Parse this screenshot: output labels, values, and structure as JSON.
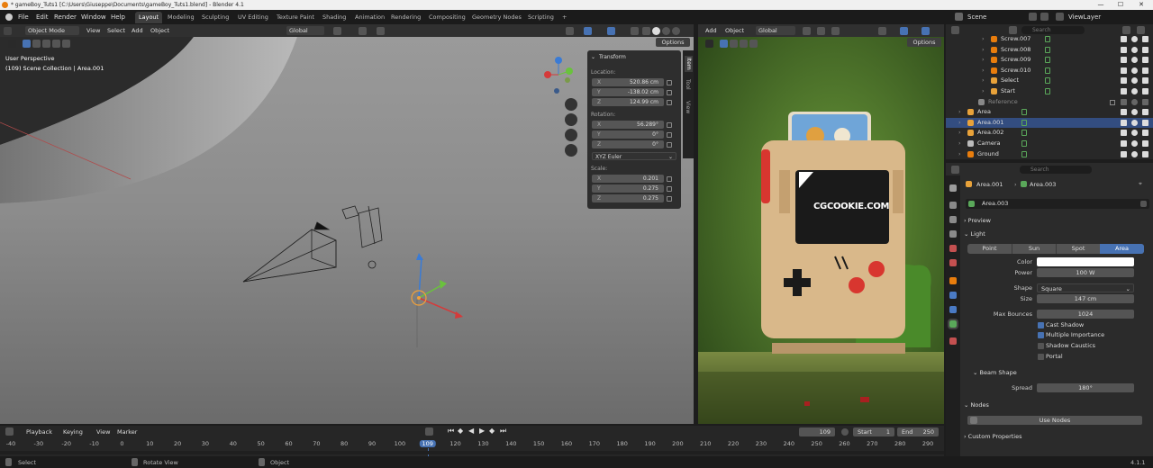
{
  "window": {
    "title": "* gameBoy_Tuts1 [C:\\Users\\Giuseppe\\Documents\\gameBoy_Tuts1.blend] - Blender 4.1"
  },
  "menubar": {
    "items": [
      "File",
      "Edit",
      "Render",
      "Window",
      "Help"
    ]
  },
  "workspaces": [
    "Layout",
    "Modeling",
    "Sculpting",
    "UV Editing",
    "Texture Paint",
    "Shading",
    "Animation",
    "Rendering",
    "Compositing",
    "Geometry Nodes",
    "Scripting"
  ],
  "workspace_add": "+",
  "scene": {
    "label": "Scene",
    "viewlayer": "ViewLayer"
  },
  "viewport_header": {
    "mode": "Object Mode",
    "view": "View",
    "select": "Select",
    "add": "Add",
    "object": "Object",
    "orientation": "Global",
    "options": "Options"
  },
  "viewport": {
    "perspective": "User Perspective",
    "collection": "(109) Scene Collection | Area.001"
  },
  "npanel": {
    "title": "Transform",
    "location_label": "Location:",
    "location": [
      {
        "axis": "X",
        "value": "520.86 cm"
      },
      {
        "axis": "Y",
        "value": "-138.02 cm"
      },
      {
        "axis": "Z",
        "value": "124.99 cm"
      }
    ],
    "rotation_label": "Rotation:",
    "rotation": [
      {
        "axis": "X",
        "value": "56.289°"
      },
      {
        "axis": "Y",
        "value": "0°"
      },
      {
        "axis": "Z",
        "value": "0°"
      }
    ],
    "rotation_mode": "XYZ Euler",
    "scale_label": "Scale:",
    "scale": [
      {
        "axis": "X",
        "value": "0.201"
      },
      {
        "axis": "Y",
        "value": "0.275"
      },
      {
        "axis": "Z",
        "value": "0.275"
      }
    ],
    "tabs": [
      "Item",
      "Tool",
      "View"
    ]
  },
  "render_header": {
    "add": "Add",
    "object": "Object",
    "orientation": "Global",
    "options": "Options"
  },
  "render_view": {
    "watermark": "CGCOOKIE.COM"
  },
  "outliner": {
    "search_placeholder": "Search",
    "rows": [
      {
        "name": "Screw.007",
        "type": "mesh"
      },
      {
        "name": "Screw.008",
        "type": "mesh"
      },
      {
        "name": "Screw.009",
        "type": "mesh"
      },
      {
        "name": "Screw.010",
        "type": "mesh"
      },
      {
        "name": "Select",
        "type": "text"
      },
      {
        "name": "Start",
        "type": "text"
      },
      {
        "name": "Reference",
        "type": "collection"
      },
      {
        "name": "Area",
        "type": "light"
      },
      {
        "name": "Area.001",
        "type": "light",
        "selected": true
      },
      {
        "name": "Area.002",
        "type": "light"
      },
      {
        "name": "Camera",
        "type": "camera"
      },
      {
        "name": "Ground",
        "type": "mesh"
      }
    ]
  },
  "properties": {
    "search_placeholder": "Search",
    "breadcrumb": [
      "Area.001",
      "Area.003"
    ],
    "datablock": "Area.003",
    "sections": {
      "preview": "Preview",
      "light": "Light",
      "beam": "Beam Shape",
      "nodes": "Nodes",
      "custom": "Custom Properties"
    },
    "light_types": [
      "Point",
      "Sun",
      "Spot",
      "Area"
    ],
    "active_type": "Area",
    "color_label": "Color",
    "color_value": "#ffffff",
    "power_label": "Power",
    "power": "100 W",
    "shape_label": "Shape",
    "shape": "Square",
    "size_label": "Size",
    "size": "147 cm",
    "bounces_label": "Max Bounces",
    "bounces": "1024",
    "checks": [
      {
        "label": "Cast Shadow",
        "on": true
      },
      {
        "label": "Multiple Importance",
        "on": true
      },
      {
        "label": "Shadow Caustics",
        "on": false
      },
      {
        "label": "Portal",
        "on": false
      }
    ],
    "spread_label": "Spread",
    "spread": "180°",
    "use_nodes": "Use Nodes"
  },
  "timeline": {
    "menu": [
      "Playback",
      "Keying",
      "View",
      "Marker"
    ],
    "current_frame": "109",
    "start_label": "Start",
    "start": "1",
    "end_label": "End",
    "end": "250",
    "ticks": [
      "-40",
      "-30",
      "-20",
      "-10",
      "0",
      "10",
      "20",
      "30",
      "40",
      "50",
      "60",
      "70",
      "80",
      "90",
      "100",
      "109",
      "120",
      "130",
      "140",
      "150",
      "160",
      "170",
      "180",
      "190",
      "200",
      "210",
      "220",
      "230",
      "240",
      "250",
      "260",
      "270",
      "280",
      "290"
    ]
  },
  "statusbar": {
    "select": "Select",
    "rotate": "Rotate View",
    "object": "Object",
    "version": "4.1.1"
  },
  "colors": {
    "accent": "#4772b3",
    "selected_row": "#334d80",
    "light_icon": "#e8a23a",
    "mesh_icon": "#e87d0d"
  }
}
